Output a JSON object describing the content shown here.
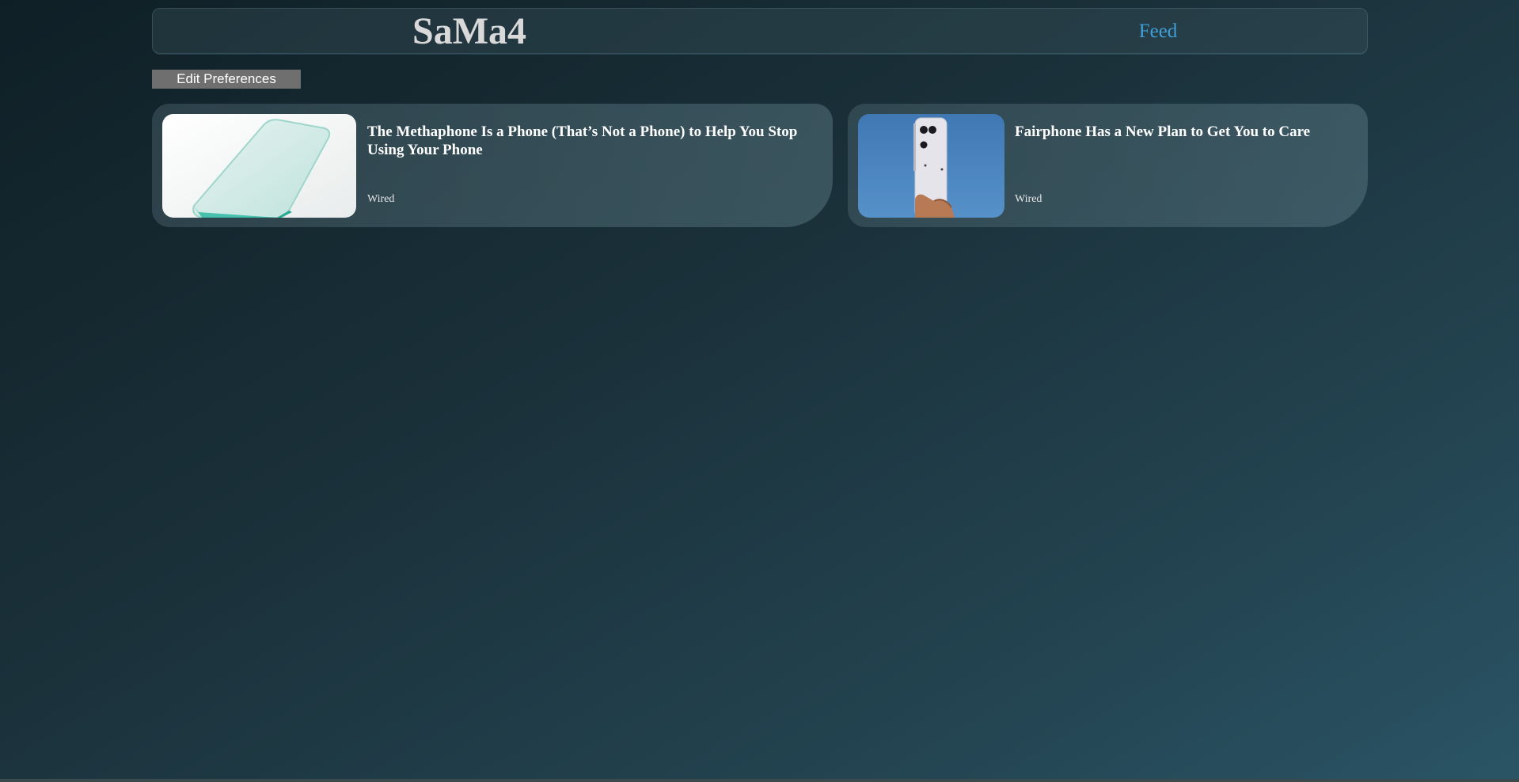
{
  "header": {
    "brand": "SaMa4",
    "nav_feed": "Feed"
  },
  "toolbar": {
    "edit_preferences_label": "Edit Preferences"
  },
  "articles": [
    {
      "title": "The Methaphone Is a Phone (That’s Not a Phone) to Help You Stop Using Your Phone",
      "source": "Wired",
      "image": "glass-phone-slab-photo"
    },
    {
      "title": "Fairphone Has a New Plan to Get You to Care",
      "source": "Wired",
      "image": "hand-holding-white-phone-photo"
    }
  ],
  "colors": {
    "accent_link": "#3f9fd8",
    "button_bg": "#6f6f6f",
    "brand_text": "#d9d9d9"
  }
}
